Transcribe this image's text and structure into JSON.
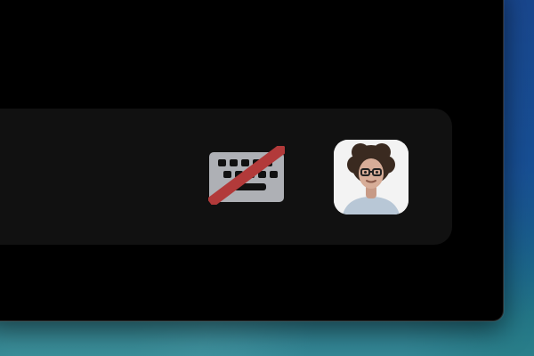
{
  "toolbar": {
    "keyboard_toggle": {
      "state": "disabled",
      "icon": "keyboard-off-icon"
    },
    "avatar": {
      "icon": "user-avatar-photo"
    }
  },
  "colors": {
    "window_bg": "#000000",
    "toolbar_bg": "#111111",
    "keyboard_key": "#aeb0b5",
    "slash_red": "#b23a3a"
  }
}
